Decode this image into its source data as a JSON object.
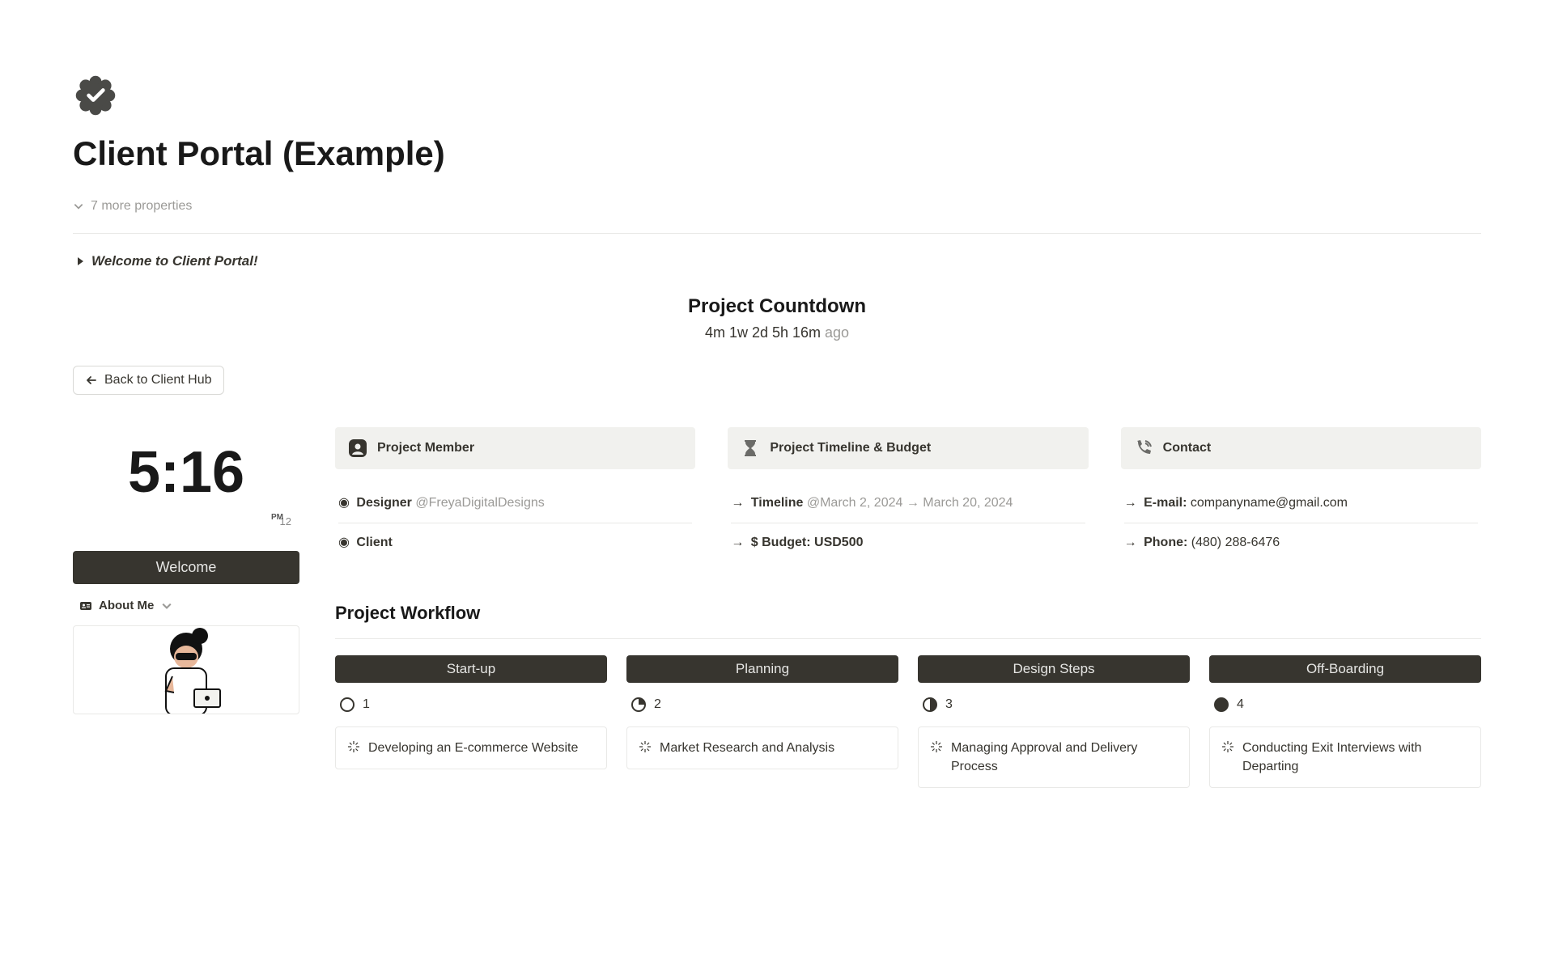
{
  "pageTitle": "Client Portal (Example)",
  "morePropsLabel": "7 more properties",
  "welcomeToggle": "Welcome to Client Portal!",
  "countdown": {
    "title": "Project Countdown",
    "time": "4m 1w 2d 5h 16m",
    "ago": " ago"
  },
  "backButton": "Back to Client Hub",
  "clock": {
    "time": "5:16",
    "ampm": "PM",
    "date": "12"
  },
  "sidebar": {
    "welcome": "Welcome",
    "aboutMe": "About Me"
  },
  "cards": {
    "member": {
      "title": "Project Member",
      "designerLabel": "Designer",
      "designerHandle": "@FreyaDigitalDesigns",
      "clientLabel": "Client"
    },
    "timeline": {
      "title": "Project Timeline & Budget",
      "timelineLabel": "Timeline",
      "timelineValue": "@March 2, 2024 → March 20, 2024",
      "budgetLabel": "$ Budget:",
      "budgetValue": "USD500"
    },
    "contact": {
      "title": "Contact",
      "emailLabel": "E-mail:",
      "emailValue": "companyname@gmail.com",
      "phoneLabel": "Phone:",
      "phoneValue": "(480) 288-6476"
    }
  },
  "workflow": {
    "title": "Project Workflow",
    "cols": [
      {
        "name": "Start-up",
        "num": "1",
        "circle": "empty",
        "task": "Developing an E-commerce Website"
      },
      {
        "name": "Planning",
        "num": "2",
        "circle": "q1",
        "task": "Market Research and Analysis"
      },
      {
        "name": "Design Steps",
        "num": "3",
        "circle": "q2",
        "task": "Managing Approval and Delivery Process"
      },
      {
        "name": "Off-Boarding",
        "num": "4",
        "circle": "full",
        "task": "Conducting Exit Interviews with Departing"
      }
    ]
  }
}
